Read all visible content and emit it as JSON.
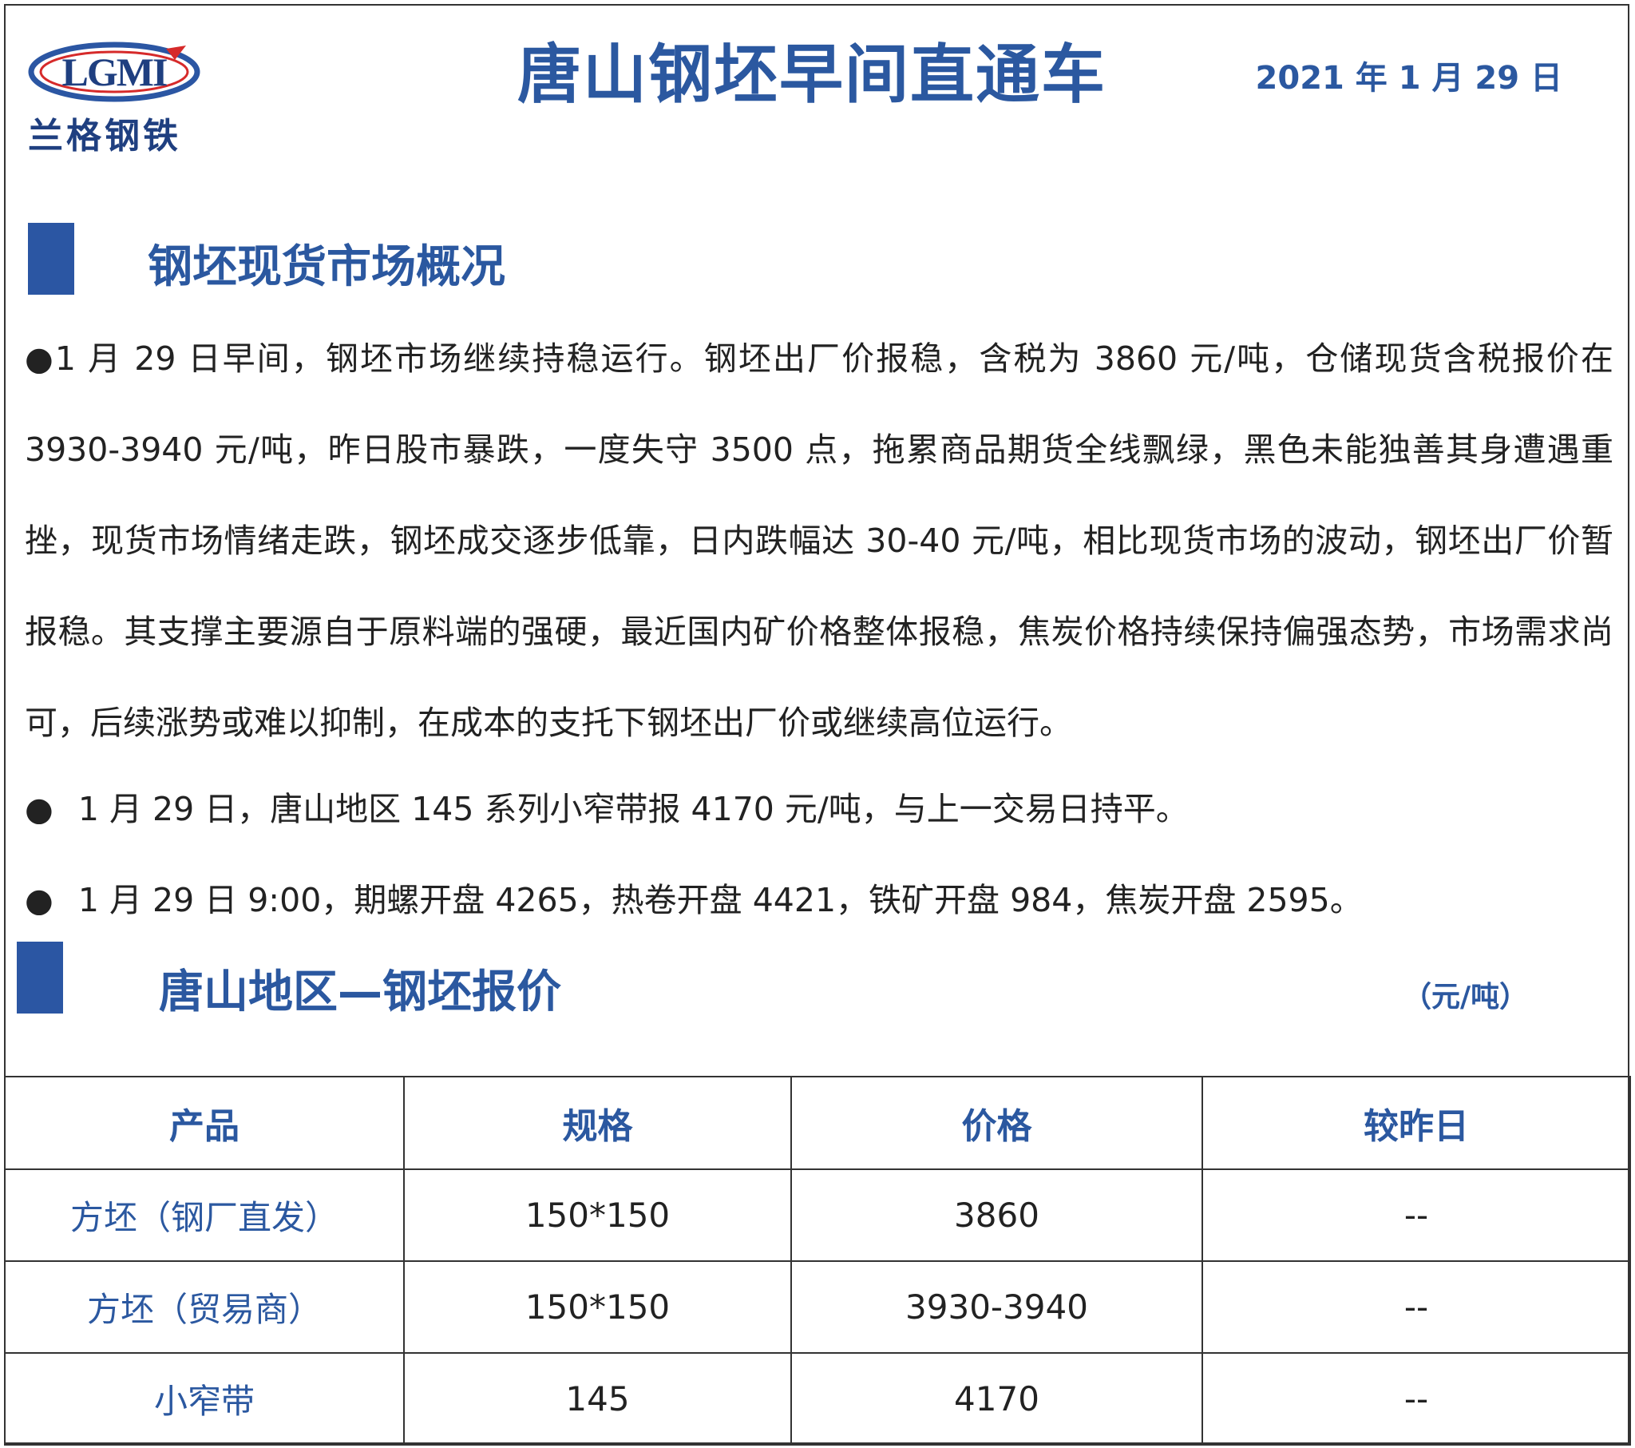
{
  "header": {
    "logo_text": "LGMI",
    "logo_subtitle": "兰格钢铁",
    "title": "唐山钢坯早间直通车",
    "date": "2021 年 1 月 29 日"
  },
  "colors": {
    "accent": "#2b58a0",
    "bar": "#2b56a3",
    "logo_red": "#d62a2a",
    "text": "#222222"
  },
  "section1": {
    "title": "钢坯现货市场概况",
    "paragraph": "●1 月 29 日早间，钢坯市场继续持稳运行。钢坯出厂价报稳，含税为 3860 元/吨，仓储现货含税报价在 3930-3940 元/吨，昨日股市暴跌，一度失守 3500 点，拖累商品期货全线飘绿，黑色未能独善其身遭遇重挫，现货市场情绪走跌，钢坯成交逐步低靠，日内跌幅达 30-40 元/吨，相比现货市场的波动，钢坯出厂价暂报稳。其支撑主要源自于原料端的强硬，最近国内矿价格整体报稳，焦炭价格持续保持偏强态势，市场需求尚可，后续涨势或难以抑制，在成本的支托下钢坯出厂价或继续高位运行。",
    "bullet_glyph": "●",
    "bullet1": "1 月 29 日，唐山地区 145 系列小窄带报 4170 元/吨，与上一交易日持平。",
    "bullet2": "1 月 29 日 9:00，期螺开盘 4265，热卷开盘 4421，铁矿开盘 984，焦炭开盘 2595。"
  },
  "section2": {
    "title": "唐山地区—钢坯报价",
    "unit": "（元/吨）"
  },
  "table": {
    "headers": [
      "产品",
      "规格",
      "价格",
      "较昨日"
    ],
    "rows": [
      {
        "product": "方坯（钢厂直发）",
        "spec": "150*150",
        "price": "3860",
        "change": "--"
      },
      {
        "product": "方坯（贸易商）",
        "spec": "150*150",
        "price": "3930-3940",
        "change": "--"
      },
      {
        "product": "小窄带",
        "spec": "145",
        "price": "4170",
        "change": "--"
      }
    ]
  }
}
